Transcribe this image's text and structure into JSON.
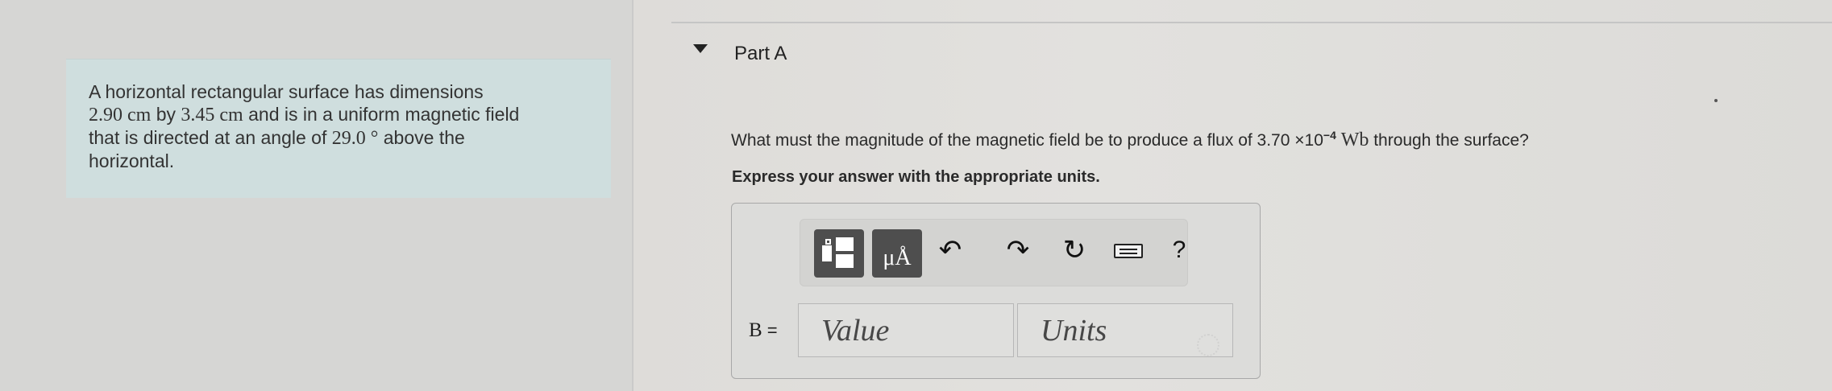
{
  "problem": {
    "line1": "A horizontal rectangular surface has dimensions",
    "dim1": "2.90 cm",
    "line2_mid": " by ",
    "dim2": "3.45 cm",
    "line2_end": " and is in a uniform magnetic field",
    "line3_start": "that is directed at an angle of ",
    "angle": "29.0 °",
    "line3_end": " above the",
    "line4": "horizontal."
  },
  "part": {
    "title": "Part A"
  },
  "question": {
    "prefix": "What must the magnitude of the magnetic field be to produce a flux of ",
    "coefficient": "3.70 ×10",
    "exponent": "−4",
    "unit": "Wb",
    "suffix": " through the surface?"
  },
  "instruction": "Express your answer with the appropriate units.",
  "toolbar": {
    "units_label": "μÅ",
    "undo_icon": "↶",
    "redo_icon": "↷",
    "reset_icon": "↻",
    "help_label": "?"
  },
  "answer": {
    "variable": "B",
    "equals": " =",
    "value_placeholder": "Value",
    "units_placeholder": "Units"
  }
}
